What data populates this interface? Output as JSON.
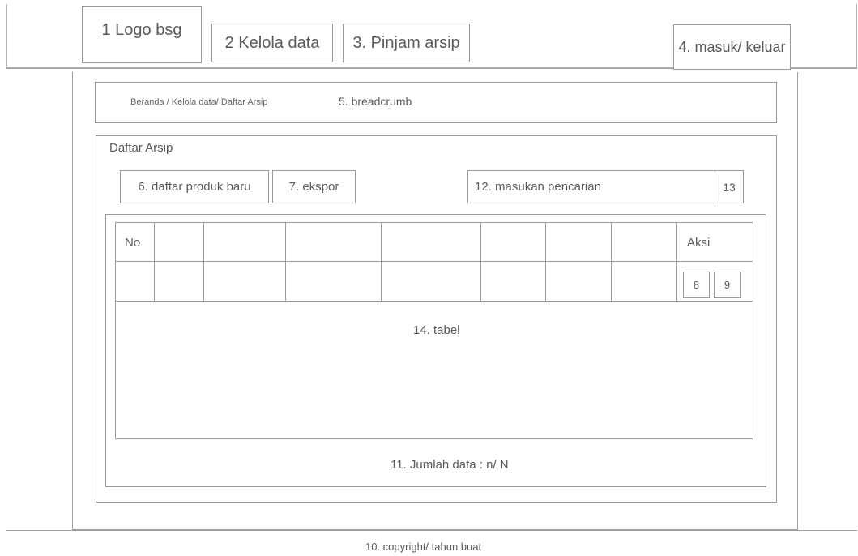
{
  "header": {
    "logo": "1 Logo bsg",
    "nav": [
      "2 Kelola data",
      "3. Pinjam arsip"
    ],
    "auth": "4. masuk/ keluar"
  },
  "breadcrumb": {
    "path": "Beranda / Kelola data/ Daftar Arsip",
    "label": "5. breadcrumb"
  },
  "panel": {
    "title": "Daftar Arsip",
    "add_button": "6. daftar produk baru",
    "export_button": "7. ekspor",
    "search_placeholder": "12. masukan pencarian",
    "search_button": "13"
  },
  "table": {
    "header_no": "No",
    "header_action": "Aksi",
    "action_buttons": [
      "8",
      "9"
    ],
    "label": "14. tabel",
    "count_text": "11. Jumlah data : n/ N"
  },
  "footer": {
    "copyright": "10. copyright/ tahun buat"
  }
}
